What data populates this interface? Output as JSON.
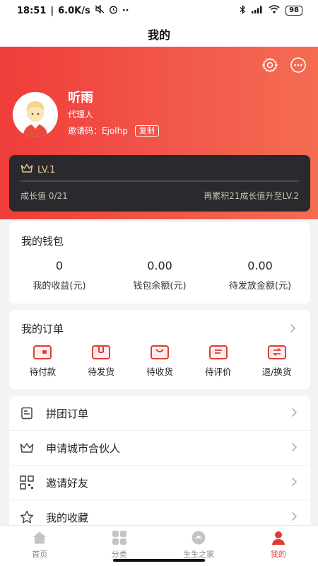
{
  "status_bar": {
    "time": "18:51",
    "network_speed": "6.0K/s",
    "battery": "98"
  },
  "header": {
    "title": "我的"
  },
  "profile": {
    "name": "听雨",
    "role": "代理人",
    "invite_label": "邀请码：",
    "invite_code": "Ejolhp",
    "copy_label": "复制"
  },
  "level": {
    "name": "LV.1",
    "growth_text": "成长值 0/21",
    "hint": "再累积21成长值升至LV.2",
    "progress": 0
  },
  "wallet": {
    "title": "我的钱包",
    "items": [
      {
        "value": "0",
        "label": "我的收益(元)"
      },
      {
        "value": "0.00",
        "label": "钱包余额(元)"
      },
      {
        "value": "0.00",
        "label": "待发放金额(元)"
      }
    ]
  },
  "orders": {
    "title": "我的订单",
    "items": [
      {
        "label": "待付款",
        "icon": "wallet-icon"
      },
      {
        "label": "待发货",
        "icon": "box-icon"
      },
      {
        "label": "待收货",
        "icon": "package-icon"
      },
      {
        "label": "待评价",
        "icon": "comment-icon"
      },
      {
        "label": "退/换货",
        "icon": "exchange-icon"
      }
    ]
  },
  "menu": [
    {
      "label": "拼团订单",
      "icon": "document-icon"
    },
    {
      "label": "申请城市合伙人",
      "icon": "crown-icon"
    },
    {
      "label": "邀请好友",
      "icon": "qr-code-icon"
    },
    {
      "label": "我的收藏",
      "icon": "star-icon"
    }
  ],
  "tabbar": [
    {
      "label": "首页",
      "icon": "home-icon"
    },
    {
      "label": "分类",
      "icon": "category-icon"
    },
    {
      "label": "生生之家",
      "icon": "family-icon"
    },
    {
      "label": "我的",
      "icon": "person-icon",
      "active": true
    }
  ],
  "colors": {
    "accent": "#e23b35",
    "gold": "#e6c58a",
    "level_card": "#2a2a2e"
  }
}
